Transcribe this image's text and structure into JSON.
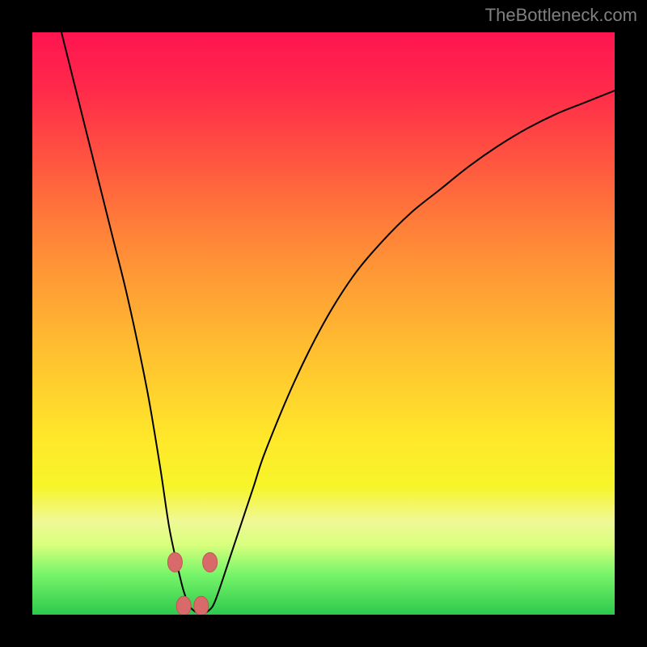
{
  "watermark": "TheBottleneck.com",
  "chart_data": {
    "type": "line",
    "title": "",
    "xlabel": "",
    "ylabel": "",
    "xlim": [
      0,
      100
    ],
    "ylim": [
      0,
      100
    ],
    "series": [
      {
        "name": "bottleneck-curve",
        "x": [
          5,
          6,
          7,
          8,
          9,
          10,
          12,
          14,
          16,
          18,
          20,
          22,
          23.5,
          25,
          26,
          27,
          28,
          29,
          30,
          31,
          32,
          34,
          36,
          38,
          40,
          45,
          50,
          55,
          60,
          65,
          70,
          75,
          80,
          85,
          90,
          95,
          100
        ],
        "y": [
          100,
          96,
          92,
          88,
          84,
          80,
          72,
          64,
          56,
          47,
          37,
          25,
          15,
          8,
          4,
          1.5,
          0.5,
          0,
          0.5,
          1.5,
          4,
          10,
          16,
          22,
          28,
          40,
          50,
          58,
          64,
          69,
          73,
          77,
          80.5,
          83.5,
          86,
          88,
          90
        ]
      }
    ],
    "highlight_points": {
      "x": [
        24.5,
        30.5,
        26,
        29
      ],
      "y": [
        9,
        9,
        1.5,
        1.5
      ]
    },
    "gradient_colors": {
      "top": "#ff1450",
      "mid": "#ffe82a",
      "bottom": "#2dc94c"
    }
  }
}
